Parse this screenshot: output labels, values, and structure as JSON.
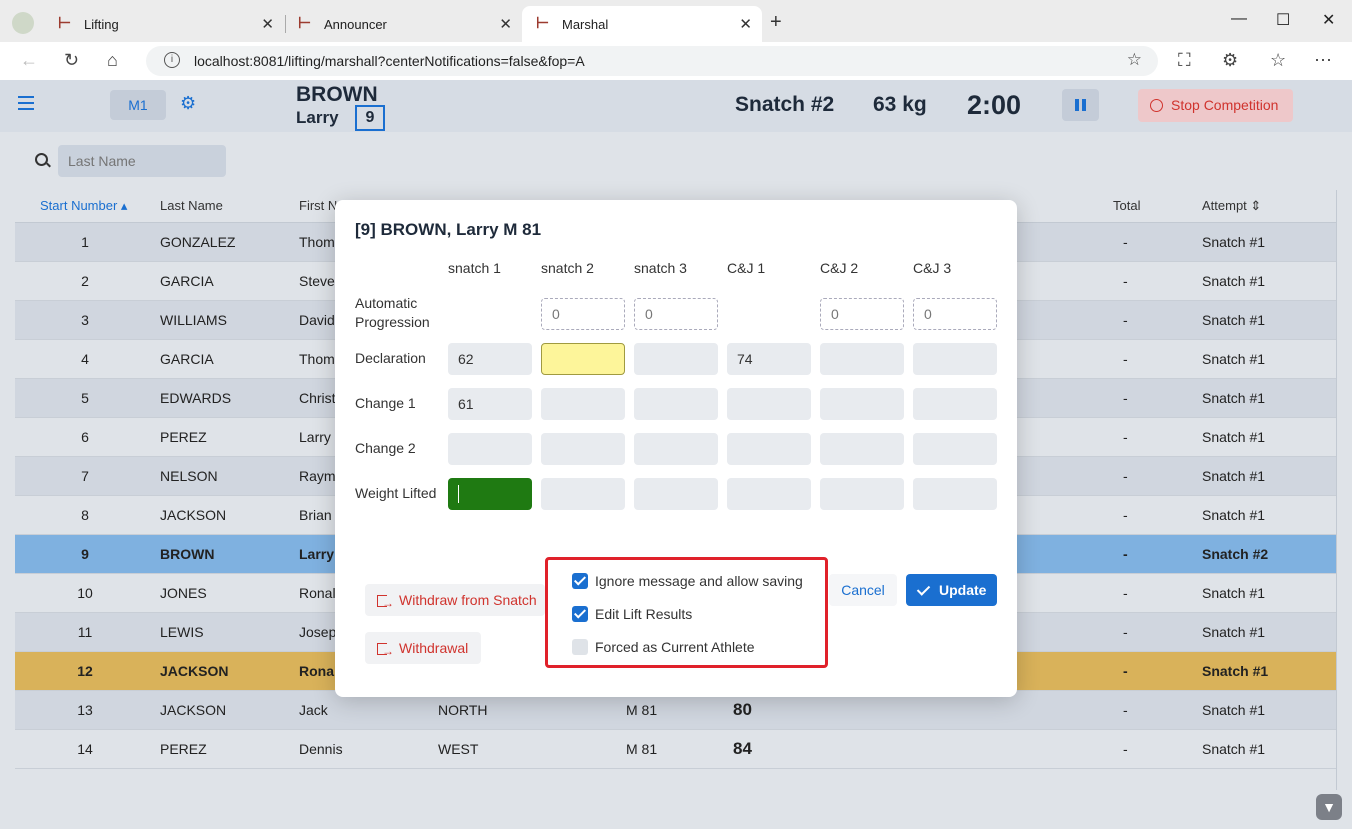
{
  "browser": {
    "tabs": [
      {
        "label": "Lifting"
      },
      {
        "label": "Announcer"
      },
      {
        "label": "Marshal"
      }
    ],
    "url": "localhost:8081/lifting/marshall?centerNotifications=false&fop=A"
  },
  "header": {
    "platform": "M1",
    "athlete_last": "BROWN",
    "athlete_first": "Larry",
    "athlete_number": "9",
    "attempt": "Snatch #2",
    "weight": "63 kg",
    "timer": "2:00",
    "stop_label": "Stop Competition"
  },
  "search": {
    "placeholder": "Last Name"
  },
  "grid": {
    "columns": {
      "start_number": "Start Number",
      "last_name": "Last Name",
      "first_name": "First N",
      "total": "Total",
      "attempt": "Attempt"
    },
    "rows": [
      {
        "num": "1",
        "last": "GONZALEZ",
        "first": "Thom",
        "team": "",
        "cat": "",
        "entry": "",
        "total": "-",
        "attempt": "Snatch #1"
      },
      {
        "num": "2",
        "last": "GARCIA",
        "first": "Steve",
        "team": "",
        "cat": "",
        "entry": "",
        "total": "-",
        "attempt": "Snatch #1"
      },
      {
        "num": "3",
        "last": "WILLIAMS",
        "first": "David",
        "team": "",
        "cat": "",
        "entry": "",
        "total": "-",
        "attempt": "Snatch #1"
      },
      {
        "num": "4",
        "last": "GARCIA",
        "first": "Thom",
        "team": "",
        "cat": "",
        "entry": "",
        "total": "-",
        "attempt": "Snatch #1"
      },
      {
        "num": "5",
        "last": "EDWARDS",
        "first": "Christ",
        "team": "",
        "cat": "",
        "entry": "",
        "total": "-",
        "attempt": "Snatch #1"
      },
      {
        "num": "6",
        "last": "PEREZ",
        "first": "Larry",
        "team": "",
        "cat": "",
        "entry": "",
        "total": "-",
        "attempt": "Snatch #1"
      },
      {
        "num": "7",
        "last": "NELSON",
        "first": "Raym",
        "team": "",
        "cat": "",
        "entry": "",
        "total": "-",
        "attempt": "Snatch #1"
      },
      {
        "num": "8",
        "last": "JACKSON",
        "first": "Brian",
        "team": "",
        "cat": "",
        "entry": "",
        "total": "-",
        "attempt": "Snatch #1"
      },
      {
        "num": "9",
        "last": "BROWN",
        "first": "Larry",
        "team": "",
        "cat": "",
        "entry": "",
        "total": "-",
        "attempt": "Snatch #2"
      },
      {
        "num": "10",
        "last": "JONES",
        "first": "Ronal",
        "team": "",
        "cat": "",
        "entry": "",
        "total": "-",
        "attempt": "Snatch #1"
      },
      {
        "num": "11",
        "last": "LEWIS",
        "first": "Josep",
        "team": "",
        "cat": "",
        "entry": "",
        "total": "-",
        "attempt": "Snatch #1"
      },
      {
        "num": "12",
        "last": "JACKSON",
        "first": "Ronal",
        "team": "",
        "cat": "",
        "entry": "",
        "total": "-",
        "attempt": "Snatch #1"
      },
      {
        "num": "13",
        "last": "JACKSON",
        "first": "Jack",
        "team": "NORTH",
        "cat": "M 81",
        "entry": "80",
        "total": "-",
        "attempt": "Snatch #1"
      },
      {
        "num": "14",
        "last": "PEREZ",
        "first": "Dennis",
        "team": "WEST",
        "cat": "M 81",
        "entry": "84",
        "total": "-",
        "attempt": "Snatch #1"
      }
    ]
  },
  "dialog": {
    "title": "[9] BROWN, Larry M 81",
    "columns": [
      "snatch 1",
      "snatch 2",
      "snatch 3",
      "C&J 1",
      "C&J 2",
      "C&J 3"
    ],
    "row_labels": {
      "auto_line1": "Automatic",
      "auto_line2": "Progression",
      "declaration": "Declaration",
      "change1": "Change 1",
      "change2": "Change 2",
      "lifted": "Weight Lifted"
    },
    "auto_progression": [
      "",
      "0",
      "0",
      "",
      "0",
      "0"
    ],
    "declaration": [
      "62",
      "",
      "",
      "74",
      "",
      ""
    ],
    "change1": [
      "61",
      "",
      "",
      "",
      "",
      ""
    ],
    "change2": [
      "",
      "",
      "",
      "",
      "",
      ""
    ],
    "lifted": [
      "",
      "",
      "",
      "",
      "",
      ""
    ],
    "withdraw_snatch": "Withdraw from Snatch",
    "withdrawal": "Withdrawal",
    "cancel": "Cancel",
    "update": "Update",
    "checkboxes": [
      {
        "label": "Ignore message and allow saving",
        "checked": true
      },
      {
        "label": "Edit Lift Results",
        "checked": true
      },
      {
        "label": "Forced as Current Athlete",
        "checked": false
      }
    ]
  },
  "colors": {
    "accent": "#1a6fd0",
    "current_row": "#7fb1e0",
    "next_row": "#d9b25a",
    "danger": "#d0332d",
    "highlight_box": "#e0212a"
  }
}
